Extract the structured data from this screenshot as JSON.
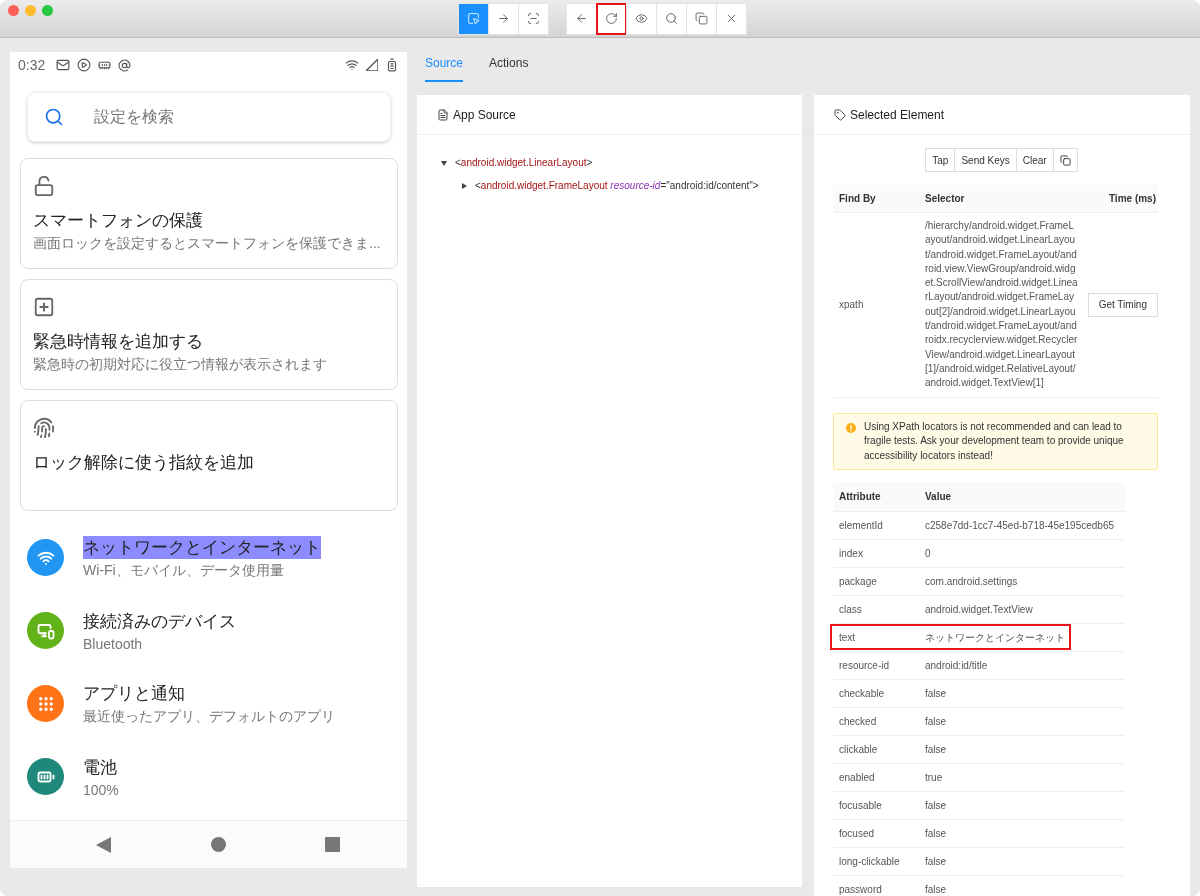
{
  "toolbar": {
    "groups": [
      [
        {
          "kind": "select",
          "selected": true,
          "highlighted": false
        },
        {
          "kind": "swipe",
          "selected": false,
          "highlighted": false
        },
        {
          "kind": "scan",
          "selected": false,
          "highlighted": false
        }
      ],
      [
        {
          "kind": "back",
          "selected": false,
          "highlighted": false
        },
        {
          "kind": "refresh",
          "selected": false,
          "highlighted": true
        },
        {
          "kind": "eye",
          "selected": false,
          "highlighted": false
        },
        {
          "kind": "search",
          "selected": false,
          "highlighted": false
        },
        {
          "kind": "copy",
          "selected": false,
          "highlighted": false
        },
        {
          "kind": "close",
          "selected": false,
          "highlighted": false
        }
      ]
    ]
  },
  "phone": {
    "status_bar": {
      "time": "0:32"
    },
    "search": {
      "placeholder": "設定を検索"
    },
    "cards": [
      {
        "kind": "lock",
        "title": "スマートフォンの保護",
        "subtitle": "画面ロックを設定するとスマートフォンを保護できま..."
      },
      {
        "kind": "plus",
        "title": "緊急時情報を追加する",
        "subtitle": "緊急時の初期対応に役立つ情報が表示されます"
      },
      {
        "kind": "fingerprint",
        "title": "ロック解除に使う指紋を追加"
      }
    ],
    "items": [
      {
        "kind": "wifi",
        "color": "#2196f3",
        "title": "ネットワークとインターネット",
        "subtitle": "Wi-Fi、モバイル、データ使用量",
        "highlighted": true
      },
      {
        "kind": "devices",
        "color": "#62b31a",
        "title": "接続済みのデバイス",
        "subtitle": "Bluetooth",
        "highlighted": false
      },
      {
        "kind": "apps",
        "color": "#ff7316",
        "title": "アプリと通知",
        "subtitle": "最近使ったアプリ、デフォルトのアプリ",
        "highlighted": false
      },
      {
        "kind": "battery",
        "color": "#1e887b",
        "title": "電池",
        "subtitle": "100%",
        "highlighted": false
      }
    ]
  },
  "tabs": [
    {
      "label": "Source",
      "selected": true
    },
    {
      "label": "Actions",
      "selected": false
    }
  ],
  "app_source": {
    "title": "App Source",
    "tree": [
      {
        "parts": [
          {
            "kind": "punct",
            "text": "<"
          },
          {
            "kind": "tag",
            "text": "android.widget.LinearLayout"
          },
          {
            "kind": "punct",
            "text": ">"
          }
        ],
        "expanded": true,
        "children": [
          {
            "parts": [
              {
                "kind": "punct",
                "text": "<"
              },
              {
                "kind": "tag",
                "text": "android.widget.FrameLayout"
              },
              {
                "kind": "attr",
                "text": " resource-id"
              },
              {
                "kind": "punct",
                "text": "=\"android:id/content\">"
              }
            ],
            "expanded": false
          }
        ]
      }
    ]
  },
  "selected_element": {
    "title": "Selected Element",
    "actions": [
      "Tap",
      "Send Keys",
      "Clear"
    ],
    "selector_table": {
      "columns": [
        "Find By",
        "Selector",
        "Time (ms)"
      ],
      "rows": [
        {
          "find_by": "xpath",
          "selector": "/hierarchy/android.widget.FrameLayout/android.widget.LinearLayout/android.widget.FrameLayout/android.view.ViewGroup/android.widget.ScrollView/android.widget.LinearLayout/android.widget.FrameLayout[2]/android.widget.LinearLayout/android.widget.FrameLayout/androidx.recyclerview.widget.RecyclerView/android.widget.LinearLayout[1]/android.widget.RelativeLayout/android.widget.TextView[1]",
          "button": "Get Timing"
        }
      ]
    },
    "warning": "Using XPath locators is not recommended and can lead to fragile tests. Ask your development team to provide unique accessibility locators instead!",
    "attributes": {
      "columns": [
        "Attribute",
        "Value"
      ],
      "rows": [
        {
          "name": "elementId",
          "value": "c258e7dd-1cc7-45ed-b718-45e195cedb65",
          "highlighted": false
        },
        {
          "name": "index",
          "value": "0",
          "highlighted": false
        },
        {
          "name": "package",
          "value": "com.android.settings",
          "highlighted": false
        },
        {
          "name": "class",
          "value": "android.widget.TextView",
          "highlighted": false
        },
        {
          "name": "text",
          "value": "ネットワークとインターネット",
          "highlighted": true
        },
        {
          "name": "resource-id",
          "value": "android:id/title",
          "highlighted": false
        },
        {
          "name": "checkable",
          "value": "false",
          "highlighted": false
        },
        {
          "name": "checked",
          "value": "false",
          "highlighted": false
        },
        {
          "name": "clickable",
          "value": "false",
          "highlighted": false
        },
        {
          "name": "enabled",
          "value": "true",
          "highlighted": false
        },
        {
          "name": "focusable",
          "value": "false",
          "highlighted": false
        },
        {
          "name": "focused",
          "value": "false",
          "highlighted": false
        },
        {
          "name": "long-clickable",
          "value": "false",
          "highlighted": false
        },
        {
          "name": "password",
          "value": "false",
          "highlighted": false
        }
      ]
    }
  }
}
